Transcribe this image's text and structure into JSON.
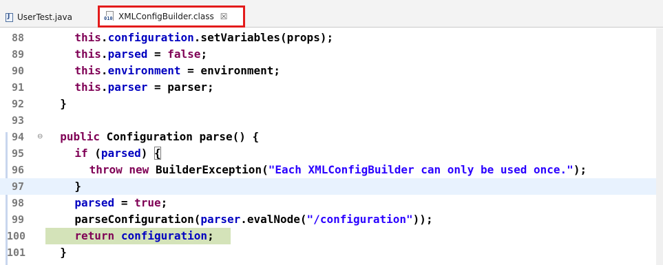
{
  "tabs": [
    {
      "label": "UserTest.java",
      "icon": "java-file-icon",
      "active": false
    },
    {
      "label": "XMLConfigBuilder.class",
      "icon": "class-file-icon",
      "active": true,
      "close_glyph": "☒"
    }
  ],
  "colors": {
    "keyword": "#7f0055",
    "field": "#0000c0",
    "string": "#2a00ff",
    "highlight_outline": "#e31b1b",
    "current_line": "#e8f2fe",
    "debug_line": "#d4e3b9"
  },
  "editor": {
    "lines": [
      {
        "n": "88",
        "indent": 4,
        "tokens": [
          [
            "kw",
            "this"
          ],
          [
            "p",
            "."
          ],
          [
            "fld",
            "configuration"
          ],
          [
            "p",
            ".setVariables("
          ],
          [
            "p",
            "props"
          ],
          [
            "p",
            ");"
          ]
        ]
      },
      {
        "n": "89",
        "indent": 4,
        "tokens": [
          [
            "kw",
            "this"
          ],
          [
            "p",
            "."
          ],
          [
            "fld",
            "parsed"
          ],
          [
            "p",
            " = "
          ],
          [
            "kw",
            "false"
          ],
          [
            "p",
            ";"
          ]
        ]
      },
      {
        "n": "90",
        "indent": 4,
        "tokens": [
          [
            "kw",
            "this"
          ],
          [
            "p",
            "."
          ],
          [
            "fld",
            "environment"
          ],
          [
            "p",
            " = environment;"
          ]
        ]
      },
      {
        "n": "91",
        "indent": 4,
        "tokens": [
          [
            "kw",
            "this"
          ],
          [
            "p",
            "."
          ],
          [
            "fld",
            "parser"
          ],
          [
            "p",
            " = parser;"
          ]
        ]
      },
      {
        "n": "92",
        "indent": 2,
        "tokens": [
          [
            "p",
            "}"
          ]
        ]
      },
      {
        "n": "93",
        "indent": 0,
        "tokens": []
      },
      {
        "n": "94",
        "fold": "⊖",
        "indent": 2,
        "tokens": [
          [
            "kw",
            "public"
          ],
          [
            "p",
            " Configuration parse() {"
          ]
        ]
      },
      {
        "n": "95",
        "indent": 4,
        "tokens": [
          [
            "kw",
            "if"
          ],
          [
            "p",
            " ("
          ],
          [
            "fld",
            "parsed"
          ],
          [
            "p",
            ") "
          ],
          [
            "box",
            "{"
          ]
        ]
      },
      {
        "n": "96",
        "indent": 6,
        "tokens": [
          [
            "kw",
            "throw"
          ],
          [
            "p",
            " "
          ],
          [
            "kw",
            "new"
          ],
          [
            "p",
            " BuilderException("
          ],
          [
            "str",
            "\"Each XMLConfigBuilder can only be used once.\""
          ],
          [
            "p",
            ");"
          ]
        ]
      },
      {
        "n": "97",
        "indent": 4,
        "current": true,
        "tokens": [
          [
            "p",
            "}"
          ]
        ]
      },
      {
        "n": "98",
        "indent": 4,
        "tokens": [
          [
            "fld",
            "parsed"
          ],
          [
            "p",
            " = "
          ],
          [
            "kw",
            "true"
          ],
          [
            "p",
            ";"
          ]
        ]
      },
      {
        "n": "99",
        "indent": 4,
        "tokens": [
          [
            "p",
            "parseConfiguration("
          ],
          [
            "fld",
            "parser"
          ],
          [
            "p",
            ".evalNode("
          ],
          [
            "str",
            "\"/configuration\""
          ],
          [
            "p",
            "));"
          ]
        ]
      },
      {
        "n": "100",
        "indent": 4,
        "debug": true,
        "tokens": [
          [
            "kw",
            "return"
          ],
          [
            "p",
            " "
          ],
          [
            "fld",
            "configuration"
          ],
          [
            "p",
            ";"
          ]
        ]
      },
      {
        "n": "101",
        "indent": 2,
        "tokens": [
          [
            "p",
            "}"
          ]
        ]
      }
    ]
  }
}
